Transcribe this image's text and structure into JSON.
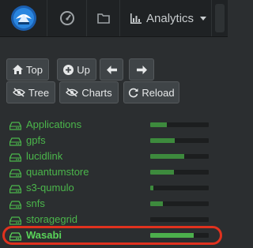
{
  "navbar": {
    "analytics_label": "Analytics",
    "icons": {
      "logo": "app-logo-icon",
      "speed": "dashboard-gauge-icon",
      "folder": "folder-icon",
      "chart": "bar-chart-icon"
    }
  },
  "toolbar": {
    "top_label": "Top",
    "up_label": "Up",
    "tree_label": "Tree",
    "charts_label": "Charts",
    "reload_label": "Reload"
  },
  "tree": {
    "items": [
      {
        "label": "Applications",
        "usage": 0.28
      },
      {
        "label": "gpfs",
        "usage": 0.42
      },
      {
        "label": "lucidlink",
        "usage": 0.58
      },
      {
        "label": "quantumstore",
        "usage": 0.4
      },
      {
        "label": "s3-qumulo",
        "usage": 0.05
      },
      {
        "label": "snfs",
        "usage": 0.21
      },
      {
        "label": "storagegrid",
        "usage": 0.0
      },
      {
        "label": "Wasabi",
        "usage": 0.74,
        "selected": true
      }
    ]
  },
  "colors": {
    "accent_green": "#4bb64b",
    "bar_fill": "#3d8a3d",
    "highlight": "#e0321e"
  }
}
